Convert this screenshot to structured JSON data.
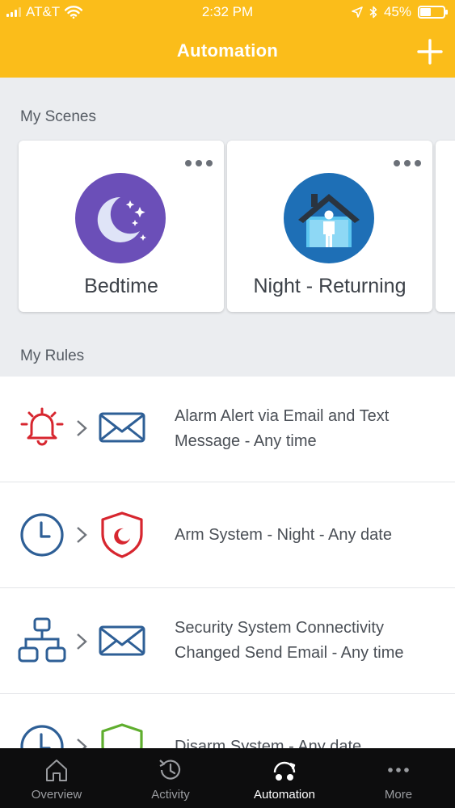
{
  "status_bar": {
    "carrier": "AT&T",
    "time": "2:32 PM",
    "battery": "45%",
    "battery_level": 0.45
  },
  "header": {
    "title": "Automation",
    "add_icon": "plus-icon"
  },
  "scenes": {
    "title": "My Scenes",
    "items": [
      {
        "name": "Bedtime",
        "icon": "moon-stars-icon",
        "menu_icon": "more-dots-icon"
      },
      {
        "name": "Night - Returning",
        "icon": "house-person-icon",
        "menu_icon": "more-dots-icon"
      }
    ]
  },
  "rules": {
    "title": "My Rules",
    "items": [
      {
        "line1": "Alarm Alert via Email and Text",
        "line2": "Message - Any time",
        "trigger_icon": "alarm-bell-icon",
        "action_icon": "envelope-icon"
      },
      {
        "line1": "Arm System - Night - Any date",
        "line2": "",
        "trigger_icon": "clock-icon",
        "action_icon": "shield-moon-icon"
      },
      {
        "line1": "Security System Connectivity",
        "line2": "Changed Send Email - Any time",
        "trigger_icon": "network-icon",
        "action_icon": "envelope-icon"
      },
      {
        "line1": "Disarm System - Any date",
        "line2": "",
        "trigger_icon": "clock-icon",
        "action_icon": "shield-icon"
      }
    ]
  },
  "tabbar": {
    "items": [
      {
        "label": "Overview",
        "icon": "home-icon"
      },
      {
        "label": "Activity",
        "icon": "history-icon"
      },
      {
        "label": "Automation",
        "icon": "automation-icon",
        "active": true
      },
      {
        "label": "More",
        "icon": "more-dots-icon"
      }
    ]
  },
  "colors": {
    "header": "#fbbd1a",
    "alert_red": "#d7262f",
    "icon_blue": "#2e5f96",
    "green": "#5fae2e",
    "tabbar": "#0d0d0e"
  }
}
